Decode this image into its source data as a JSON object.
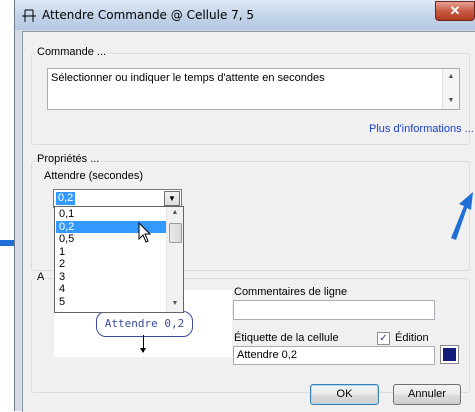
{
  "window": {
    "title": "Attendre Commande @ Cellule 7, 5",
    "close_glyph": "✕"
  },
  "commande": {
    "group_label": "Commande ...",
    "description": "Sélectionner ou indiquer le temps d'attente en secondes",
    "more_info_link": "Plus d'informations ..."
  },
  "proprietes": {
    "group_label": "Propriétés ...",
    "field_label": "Attendre (secondes)",
    "selected_value": "0,2",
    "options": [
      "0,1",
      "0,2",
      "0,5",
      "1",
      "2",
      "3",
      "4",
      "5"
    ],
    "selected_index": 1
  },
  "apercu": {
    "group_label_partial": "A",
    "node_label": "Attendre 0,2"
  },
  "commentaires": {
    "label": "Commentaires de ligne",
    "value": ""
  },
  "etiquette": {
    "label": "Étiquette de la cellule",
    "value": "Attendre 0,2",
    "edition_label": "Édition",
    "edition_checked": true,
    "color": "#141e7a"
  },
  "buttons": {
    "ok": "OK",
    "cancel": "Annuler"
  },
  "colors": {
    "annotation_arrow": "#1f6fd6",
    "selection": "#3399ff"
  }
}
